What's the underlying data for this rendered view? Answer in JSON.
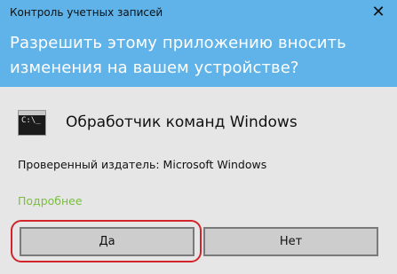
{
  "window": {
    "title": "Контроль учетных записей",
    "close_glyph": "✕"
  },
  "prompt": {
    "question": "Разрешить этому приложению вносить изменения на вашем устройстве?"
  },
  "app": {
    "icon": "cmd-icon",
    "icon_text": "C:\\_",
    "name": "Обработчик команд Windows"
  },
  "publisher": {
    "text": "Проверенный издатель: Microsoft Windows"
  },
  "details": {
    "label": "Подробнее"
  },
  "buttons": {
    "yes_label": "Да",
    "no_label": "Нет"
  },
  "colors": {
    "header": "#5fb3e8",
    "body": "#e6e6e6",
    "link": "#7abf3c",
    "highlight": "#d3242c"
  }
}
